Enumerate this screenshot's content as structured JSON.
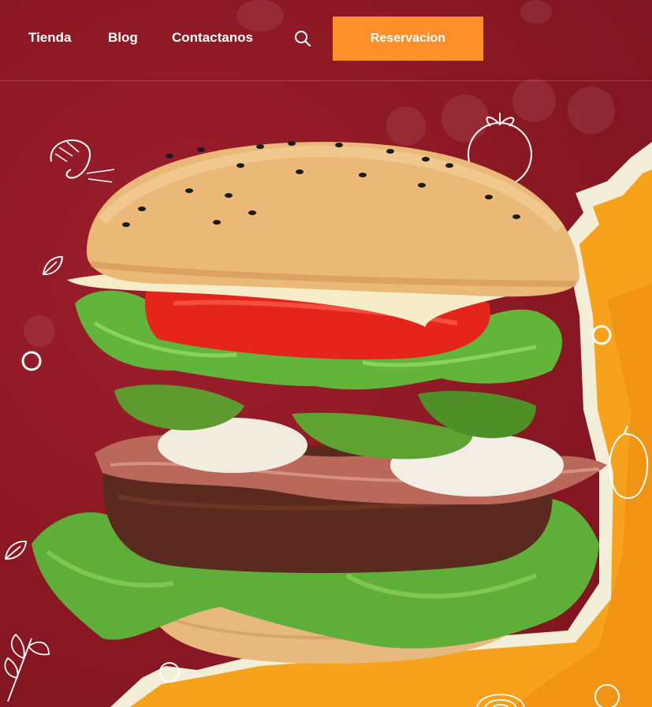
{
  "nav": {
    "links": [
      "Tienda",
      "Blog",
      "Contactanos"
    ],
    "search_icon": "search-icon",
    "cta_label": "Reservacion"
  },
  "colors": {
    "background": "#8e1a26",
    "accent": "#ff8f2b",
    "panel": "#f6a21c"
  },
  "hero": {
    "image": "burger-photo",
    "doodles": [
      "shrimp-icon",
      "tomato-icon",
      "leaf-icon",
      "pepper-icon",
      "herb-icon",
      "onion-icon"
    ]
  }
}
